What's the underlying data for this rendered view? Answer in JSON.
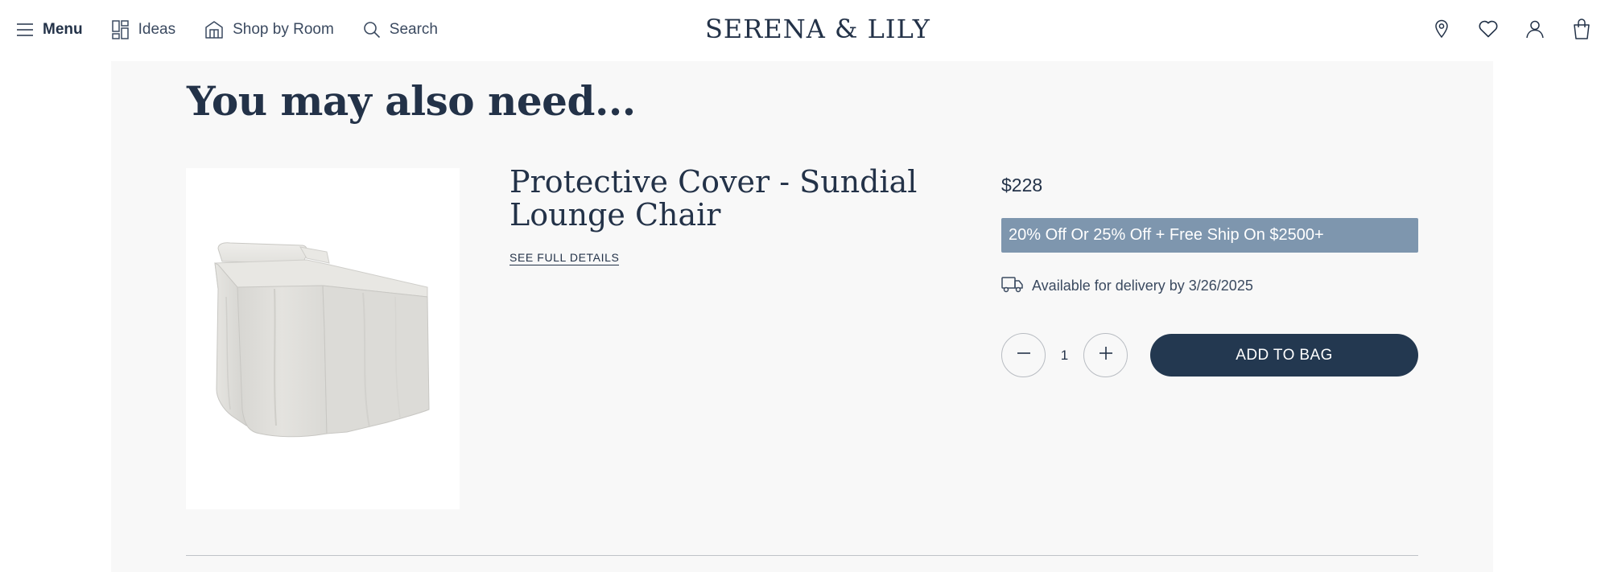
{
  "header": {
    "menu_label": "Menu",
    "ideas_label": "Ideas",
    "shop_by_room_label": "Shop by Room",
    "search_label": "Search",
    "logo_text": "SERENA & LILY",
    "icons": [
      "menu-icon",
      "ideas-icon",
      "shop-by-room-icon",
      "search-icon",
      "store-location-icon",
      "wishlist-heart-icon",
      "account-icon",
      "shopping-bag-icon"
    ]
  },
  "section": {
    "title": "You may also need..."
  },
  "product": {
    "name": "Protective Cover - Sundial Lounge Chair",
    "details_link": "SEE FULL DETAILS",
    "price": "$228",
    "promo": "20% Off Or 25% Off + Free Ship On $2500+",
    "delivery": "Available for delivery by 3/26/2025",
    "quantity": "1",
    "add_to_bag": "ADD TO BAG",
    "image_description_icon": "product-image"
  },
  "colors": {
    "brand_navy": "#233850",
    "text_navy": "#233248",
    "promo_blue": "#7e96ae",
    "panel_bg": "#f8f8f8"
  }
}
